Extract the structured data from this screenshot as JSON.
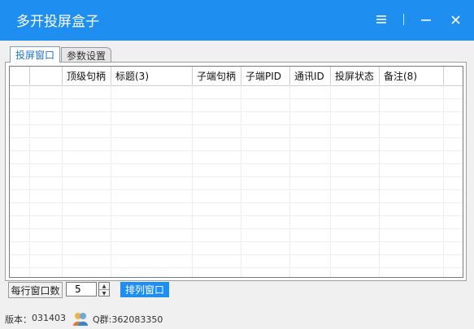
{
  "window": {
    "title": "多开投屏盒子",
    "menu_icon": "menu-icon",
    "minimize_icon": "minimize-icon",
    "close_icon": "close-icon",
    "accent_color": "#1e8ff0"
  },
  "tabs": [
    {
      "label": "投屏窗口",
      "active": true
    },
    {
      "label": "参数设置",
      "active": false
    }
  ],
  "table": {
    "columns": [
      "",
      "",
      "顶级句柄",
      "标题(3)",
      "子端句柄",
      "子端PID",
      "通讯ID",
      "投屏状态",
      "备注(8)",
      ""
    ],
    "rows": []
  },
  "controls": {
    "per_row_label": "每行窗口数",
    "per_row_value": "5",
    "arrange_button": "排列窗口"
  },
  "status": {
    "version_label": "版本：",
    "version_value": "031403",
    "qq_label": "Q群:362083350"
  }
}
